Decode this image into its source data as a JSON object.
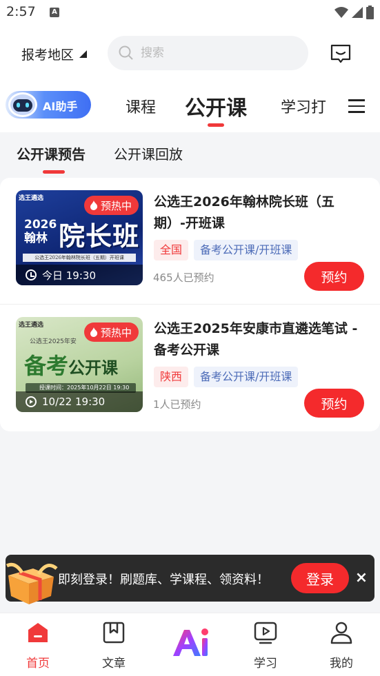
{
  "status_bar": {
    "time": "2:57",
    "notif_icon": "A"
  },
  "header": {
    "region_label": "报考地区",
    "search_placeholder": "搜索",
    "message_icon": "message-icon"
  },
  "tabs": {
    "ai_label": "AI助手",
    "items": [
      "课程",
      "公开课",
      "学习打卡"
    ],
    "active": "公开课",
    "study_tab_visible": "学习打"
  },
  "subtabs": {
    "items": [
      "公开课预告",
      "公开课回放"
    ],
    "active": "公开课预告"
  },
  "courses": [
    {
      "title": "公选王2026年翰林院长班（五期）-开班课",
      "badge": "预热中",
      "time": "今日 19:30",
      "region": "全国",
      "category": "备考公开课/开班课",
      "count": "465人已预约",
      "button": "预约",
      "thumb": {
        "top": "选王遴选",
        "year_line1": "2026",
        "year_line2": "翰林",
        "big": "院长班",
        "line": "公选王2026年翰林院长班（五期）开班课"
      }
    },
    {
      "title": "公选王2025年安康市直遴选笔试 -备考公开课",
      "badge": "预热中",
      "time": "10/22 19:30",
      "region": "陕西",
      "category": "备考公开课/开班课",
      "count": "1人已预约",
      "button": "预约",
      "thumb": {
        "top": "选王遴选",
        "sub": "公选王2025年安",
        "big_1": "备考",
        "big_2": "公开课",
        "time_line": "授课时间：2025年10月22日 19:30"
      }
    }
  ],
  "login_banner": {
    "text": "即刻登录！刷题库、学课程、领资料！",
    "button": "登录",
    "close": "×"
  },
  "bottom_nav": {
    "home": "首页",
    "article": "文章",
    "study": "学习",
    "mine": "我的"
  },
  "colors": {
    "accent": "#f0393a",
    "button": "#f42a2c",
    "ai_blue": "#3f6ff3"
  }
}
